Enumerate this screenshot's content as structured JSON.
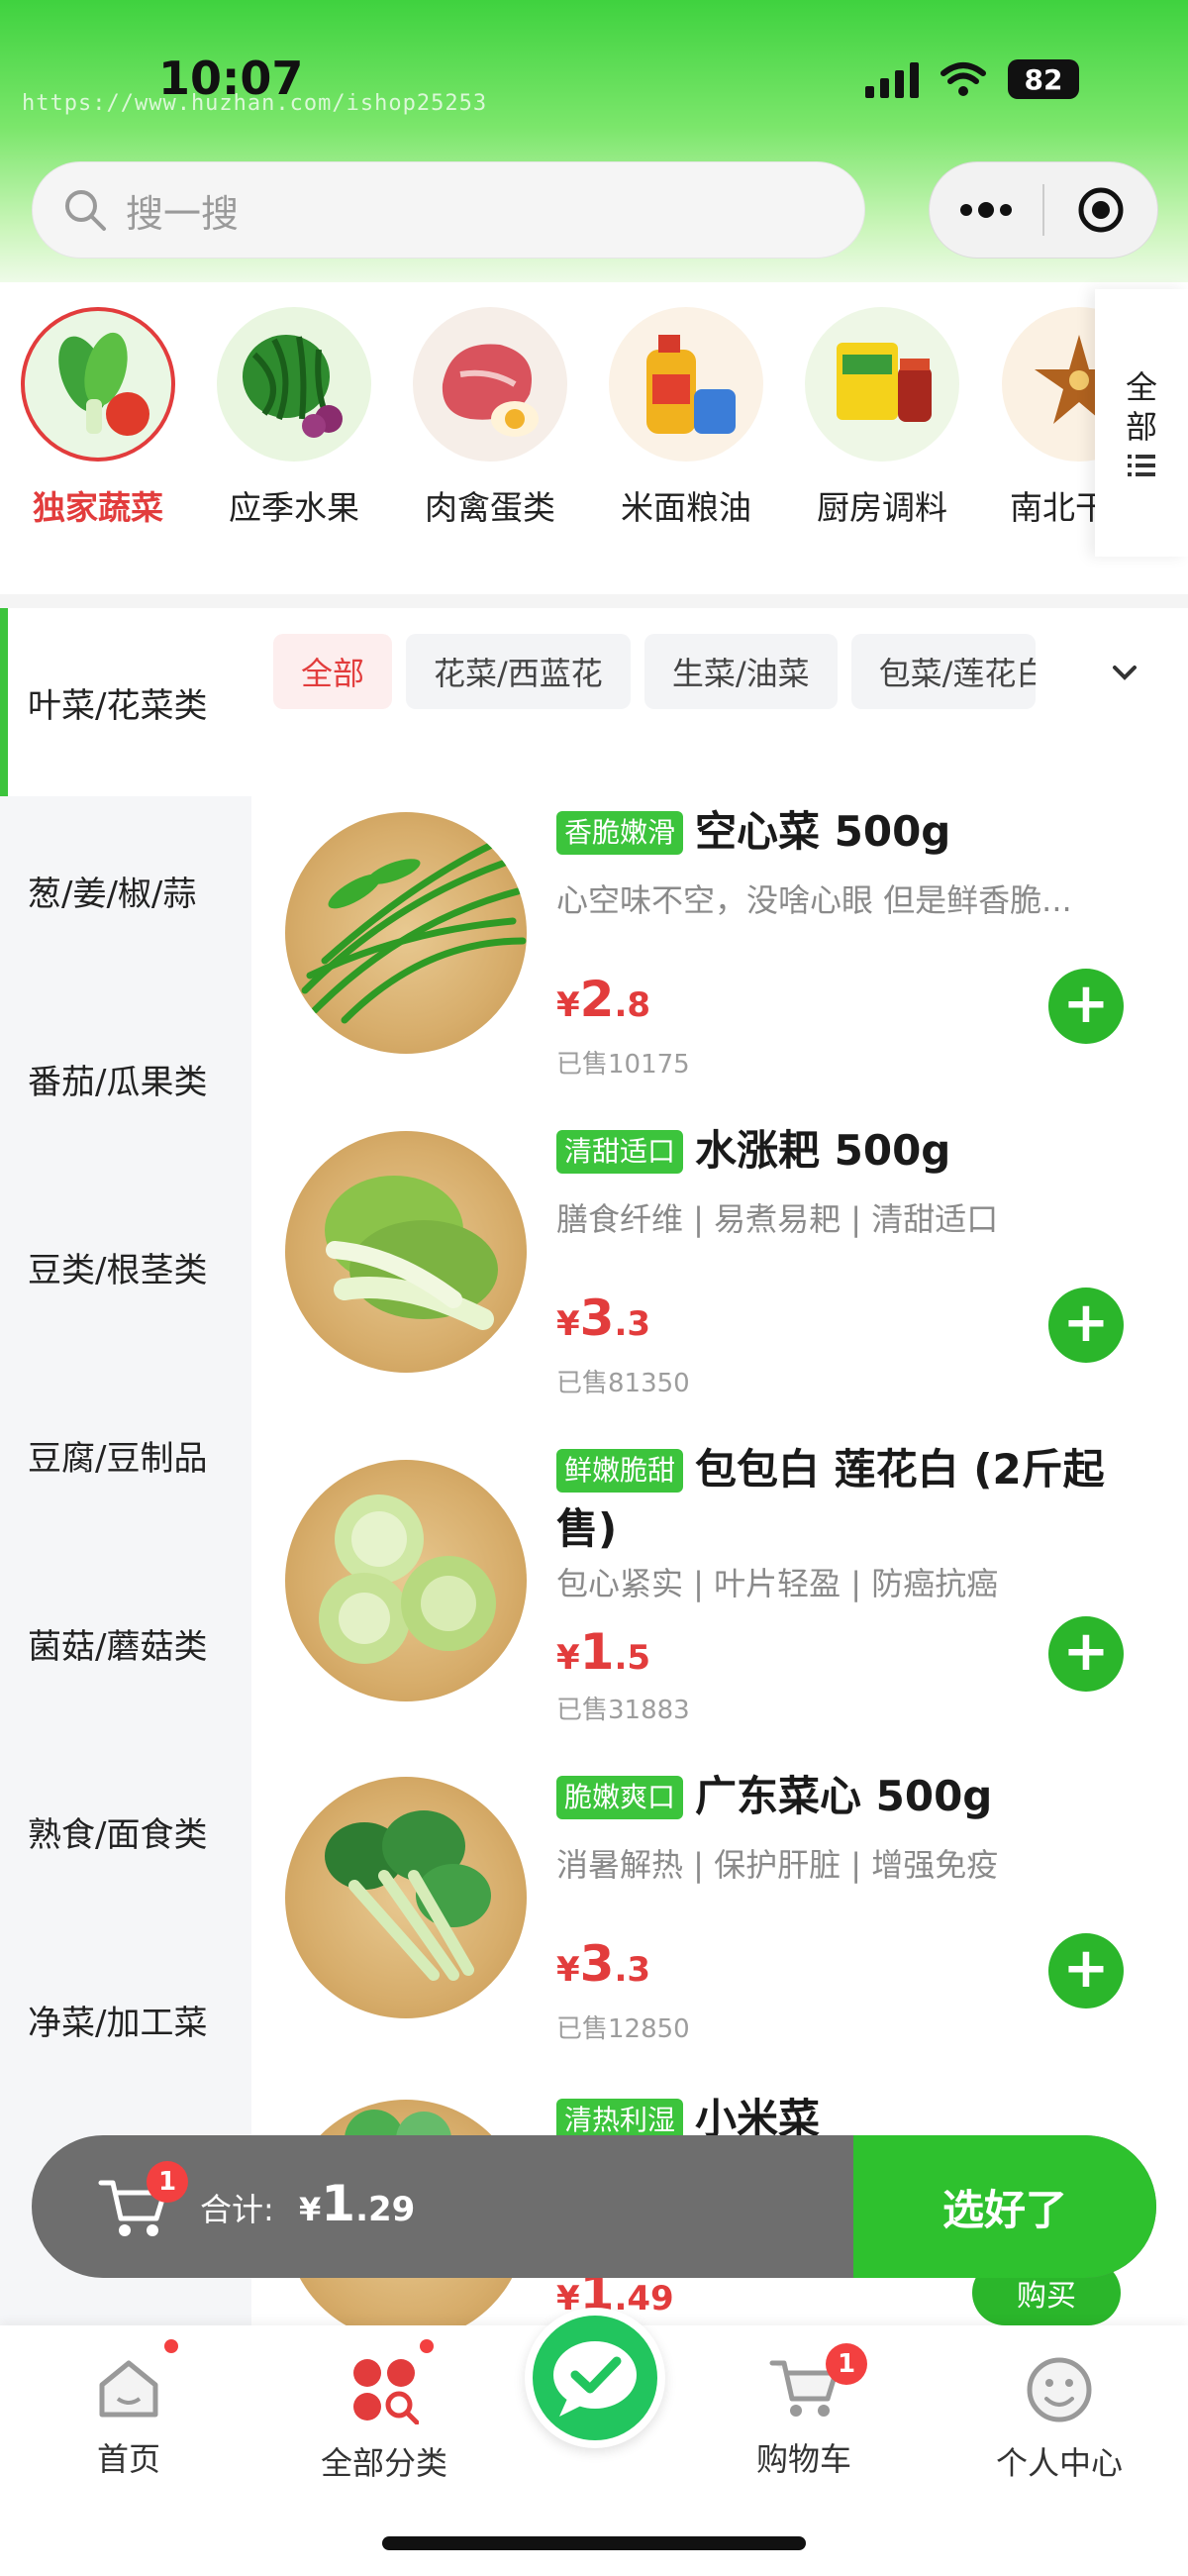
{
  "status_bar": {
    "time": "10:07",
    "battery": "82",
    "watermark": "https://www.huzhan.com/ishop25253"
  },
  "search": {
    "placeholder": "搜一搜"
  },
  "categories": [
    {
      "label": "独家蔬菜",
      "icon": "vegetable-icon"
    },
    {
      "label": "应季水果",
      "icon": "watermelon-icon"
    },
    {
      "label": "肉禽蛋类",
      "icon": "meat-egg-icon"
    },
    {
      "label": "米面粮油",
      "icon": "oil-rice-icon"
    },
    {
      "label": "厨房调料",
      "icon": "seasoning-icon"
    },
    {
      "label": "南北干",
      "icon": "dried-goods-icon"
    }
  ],
  "all_button": {
    "line1": "全",
    "line2": "部"
  },
  "sidebar": {
    "items": [
      "叶菜/花菜类",
      "葱/姜/椒/蒜",
      "番茄/瓜果类",
      "豆类/根茎类",
      "豆腐/豆制品",
      "菌菇/蘑菇类",
      "熟食/面食类",
      "净菜/加工菜"
    ]
  },
  "subtabs": [
    "全部",
    "花菜/西蓝花",
    "生菜/油菜",
    "包菜/莲花白"
  ],
  "products": [
    {
      "tag": "香脆嫩滑",
      "name": "空心菜 500g",
      "desc": "心空味不空，没啥心眼 但是鲜香脆...",
      "price_int": "2",
      "price_dec": ".8",
      "sold": "已售10175"
    },
    {
      "tag": "清甜适口",
      "name": "水涨耙 500g",
      "desc": "膳食纤维 | 易煮易耙 | 清甜适口",
      "price_int": "3",
      "price_dec": ".3",
      "sold": "已售81350"
    },
    {
      "tag": "鲜嫩脆甜",
      "name": "包包白 莲花白 (2斤起售)",
      "desc": "包心紧实 | 叶片轻盈 | 防癌抗癌",
      "price_int": "1",
      "price_dec": ".5",
      "sold": "已售31883"
    },
    {
      "tag": "脆嫩爽口",
      "name": "广东菜心 500g",
      "desc": "消暑解热 | 保护肝脏 | 增强免疫",
      "price_int": "3",
      "price_dec": ".3",
      "sold": "已售12850"
    },
    {
      "tag": "清热利湿",
      "name": "小米菜",
      "price_int": "1",
      "price_dec": ".49"
    }
  ],
  "currency": "¥",
  "cart": {
    "count": "1",
    "total_label": "合计:",
    "total_int": "1",
    "total_dec": ".29",
    "confirm": "选好了",
    "buy": "购买"
  },
  "tabbar": [
    {
      "label": "首页",
      "icon": "home-icon"
    },
    {
      "label": "全部分类",
      "icon": "category-icon"
    },
    {
      "label": "",
      "icon": "wechat-chat-icon"
    },
    {
      "label": "购物车",
      "icon": "cart-icon",
      "badge": "1"
    },
    {
      "label": "个人中心",
      "icon": "smile-icon"
    }
  ],
  "colors": {
    "accent": "#e23c3c",
    "green": "#2bb62b"
  }
}
